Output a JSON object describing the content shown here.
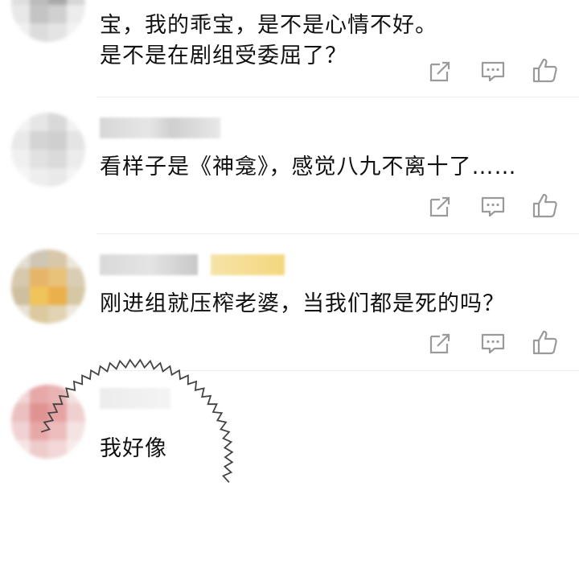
{
  "comments": [
    {
      "lines": [
        "宝，我的乖宝，是不是心情不好。",
        "是不是在剧组受委屈了？"
      ]
    },
    {
      "lines": [
        "看样子是《神龛》，感觉八九不离十了……"
      ]
    },
    {
      "lines": [
        "刚进组就压榨老婆，当我们都是死的吗？"
      ]
    },
    {
      "lines": [
        "我好像"
      ]
    }
  ],
  "icons": {
    "share": "share-icon",
    "comment": "comment-icon",
    "like": "thumbs-up-icon"
  },
  "colors": {
    "text": "#111111",
    "icon": "#9a9a9a",
    "divider": "#ededed",
    "speech_outline": "#444444"
  }
}
